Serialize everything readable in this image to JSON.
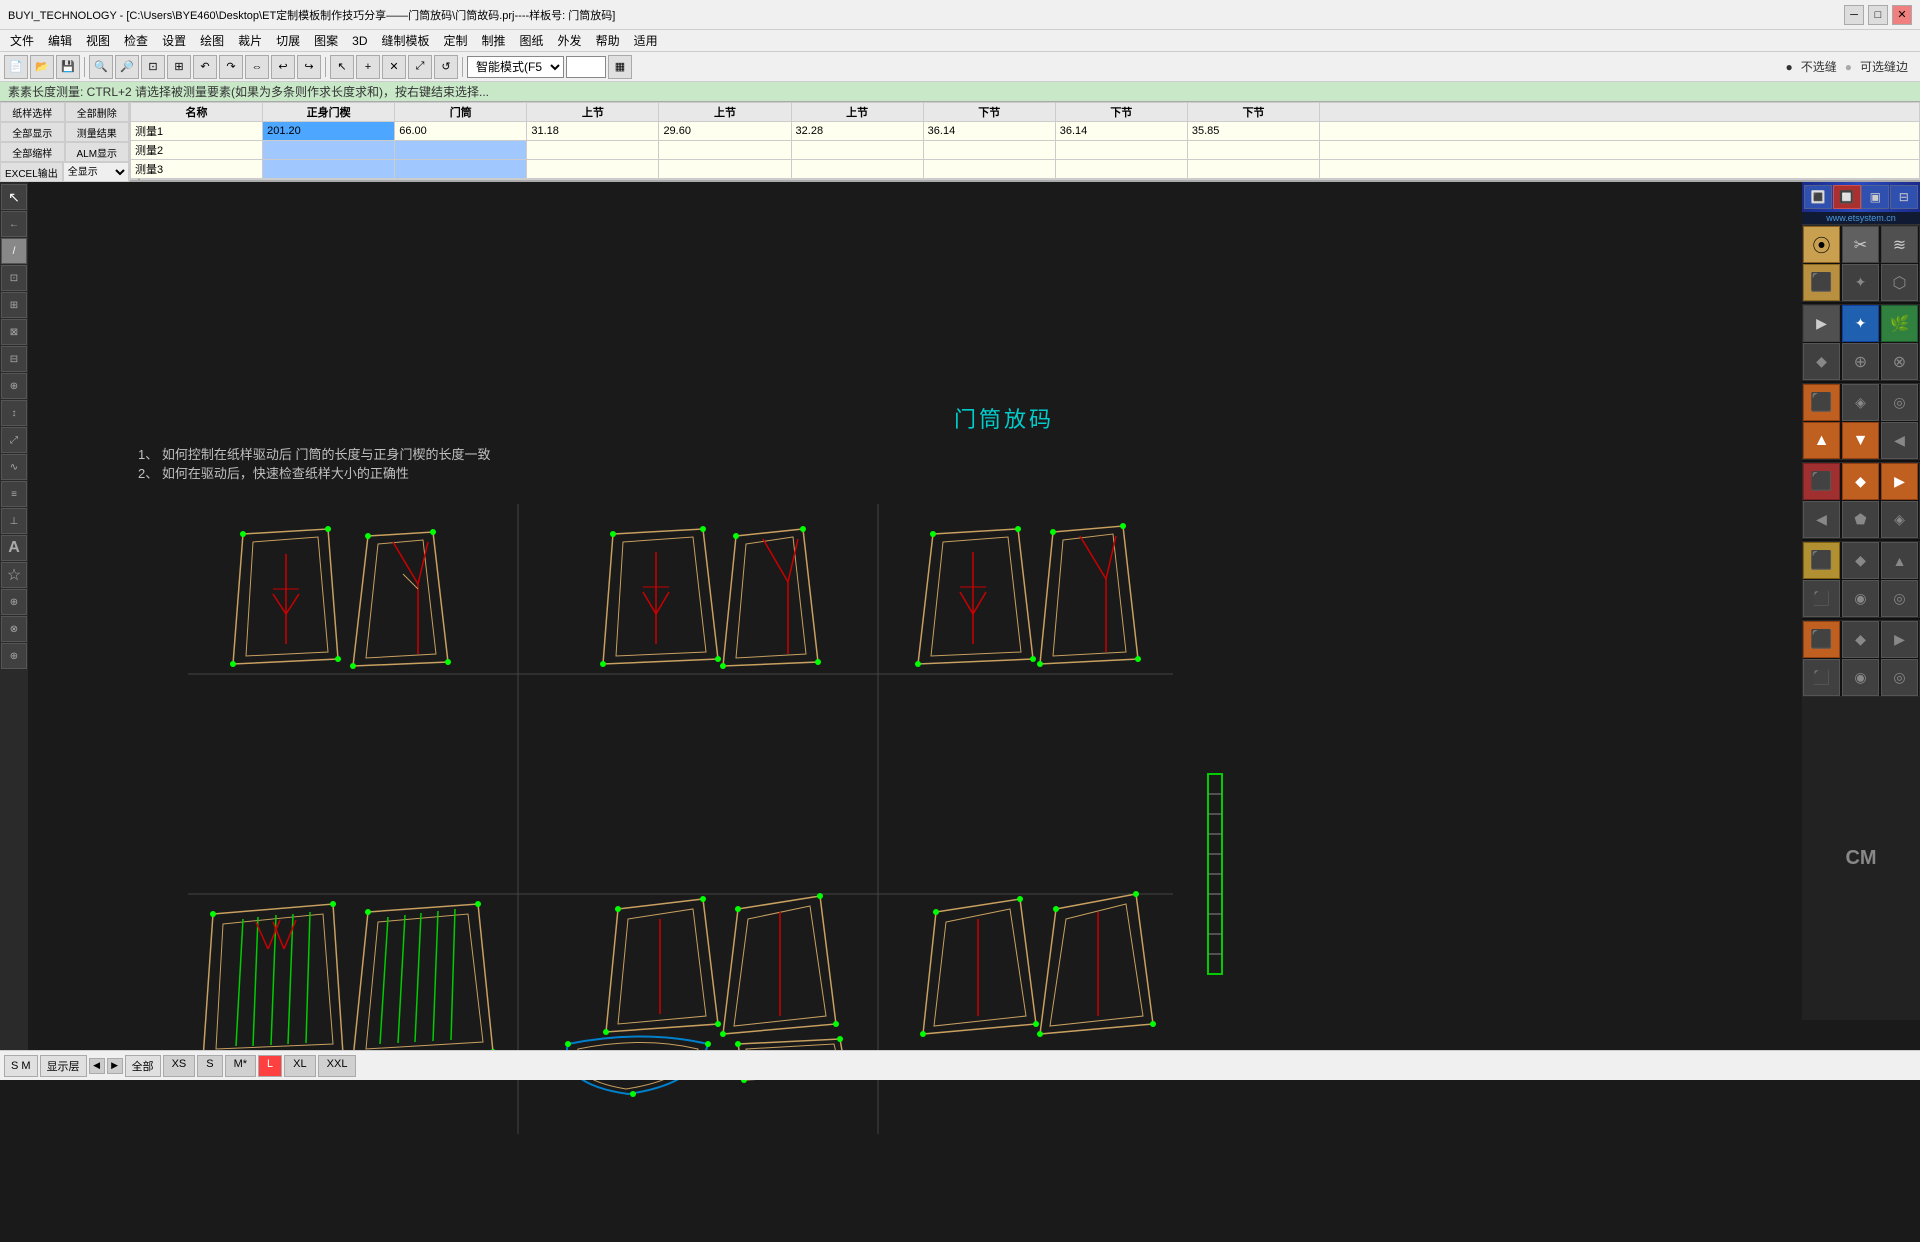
{
  "titlebar": {
    "title": "BUYI_TECHNOLOGY - [C:\\Users\\BYE460\\Desktop\\ET定制模板制作技巧分享——门筒放码\\门筒故码.prj----样板号: 门筒放码]",
    "minimize": "─",
    "maximize": "□",
    "close": "✕"
  },
  "menubar": {
    "items": [
      "文件",
      "编辑",
      "视图",
      "检查",
      "设置",
      "绘图",
      "裁片",
      "切展",
      "图案",
      "3D",
      "缝制模板",
      "定制",
      "制推",
      "图纸",
      "外发",
      "帮助",
      "适用"
    ]
  },
  "statusbar_top": {
    "text": "素素长度测量: CTRL+2  请选择被测量要素(如果为多条则作求长度求和)，按右键结束选择..."
  },
  "mode_label": "智能模式(F5",
  "mode_value": "",
  "measurement_table": {
    "headers": [
      "名称",
      "正身门楔",
      "门筒",
      "上节",
      "上节",
      "上节",
      "下节",
      "下节",
      "下节"
    ],
    "rows": [
      {
        "name": "测量1",
        "values": [
          "201.20",
          "66.00",
          "31.18",
          "29.60",
          "32.28",
          "36.14",
          "36.14",
          "35.85"
        ],
        "highlight": true
      },
      {
        "name": "测量2",
        "values": [
          "",
          "",
          "",
          "",
          "",
          "",
          "",
          ""
        ],
        "highlight": false
      },
      {
        "name": "测量3",
        "values": [
          "",
          "",
          "",
          "",
          "",
          "",
          "",
          ""
        ],
        "highlight": false
      }
    ]
  },
  "left_controls": {
    "top_buttons": [
      "全部删除",
      "测量结果",
      "ALM显示",
      "全显示"
    ],
    "bottom_label": "EXCEL输出",
    "bottom_select": "全显示"
  },
  "canvas": {
    "title": "门筒放码",
    "instructions": [
      "1、  如何控制在纸样驱动后   门筒的长度与正身门楔的长度一致",
      "2、  如何在驱动后，快速检查纸样大小的正确性"
    ]
  },
  "top_status": {
    "no_stitch": "不选缝",
    "can_stitch": "可选缝边"
  },
  "statusbar_bottom": {
    "s_m_label": "S M",
    "display_layer": "显示层",
    "all": "全部",
    "sizes": [
      "XS",
      "S",
      "M*",
      "L",
      "XL",
      "XXL"
    ],
    "active_size": "L"
  },
  "right_panel": {
    "url": "www.etsystem.cn",
    "cm_label": "CM",
    "sections": [
      {
        "buttons": [
          {
            "icon": "⦿",
            "type": "yellow"
          },
          {
            "icon": "✂",
            "type": "dark"
          },
          {
            "icon": "≋",
            "type": "dark"
          },
          {
            "icon": "⬛",
            "type": "yellow"
          },
          {
            "icon": "✦",
            "type": "dark"
          },
          {
            "icon": "⬡",
            "type": "dark"
          },
          {
            "icon": "◈",
            "type": "orange"
          },
          {
            "icon": "↗",
            "type": "dark"
          },
          {
            "icon": "⟲",
            "type": "dark"
          }
        ]
      },
      {
        "buttons": [
          {
            "icon": "▶",
            "type": "dark"
          },
          {
            "icon": "✦",
            "type": "blue"
          },
          {
            "icon": "🌿",
            "type": "green"
          },
          {
            "icon": "◆",
            "type": "dark"
          },
          {
            "icon": "⊕",
            "type": "dark"
          },
          {
            "icon": "⊗",
            "type": "dark"
          },
          {
            "icon": "⬟",
            "type": "dark"
          },
          {
            "icon": "⬠",
            "type": "dark"
          },
          {
            "icon": "◉",
            "type": "dark"
          }
        ]
      },
      {
        "buttons": [
          {
            "icon": "⬛",
            "type": "orange"
          },
          {
            "icon": "◈",
            "type": "dark"
          },
          {
            "icon": "◎",
            "type": "dark"
          },
          {
            "icon": "▲",
            "type": "orange"
          },
          {
            "icon": "▼",
            "type": "orange"
          },
          {
            "icon": "◀",
            "type": "dark"
          },
          {
            "icon": "⬡",
            "type": "dark"
          },
          {
            "icon": "⬢",
            "type": "dark"
          },
          {
            "icon": "✕",
            "type": "dark"
          }
        ]
      },
      {
        "buttons": [
          {
            "icon": "⬛",
            "type": "red"
          },
          {
            "icon": "◆",
            "type": "orange"
          },
          {
            "icon": "▶",
            "type": "orange"
          },
          {
            "icon": "◀",
            "type": "dark"
          },
          {
            "icon": "⬟",
            "type": "dark"
          },
          {
            "icon": "◈",
            "type": "dark"
          },
          {
            "icon": "⬠",
            "type": "dark"
          },
          {
            "icon": "⬡",
            "type": "dark"
          },
          {
            "icon": "✦",
            "type": "dark"
          }
        ]
      },
      {
        "buttons": [
          {
            "icon": "⬛",
            "type": "yellow"
          },
          {
            "icon": "◆",
            "type": "dark"
          },
          {
            "icon": "▲",
            "type": "dark"
          },
          {
            "icon": "⬛",
            "type": "dark"
          },
          {
            "icon": "◉",
            "type": "dark"
          },
          {
            "icon": "◎",
            "type": "dark"
          },
          {
            "icon": "⬟",
            "type": "dark"
          },
          {
            "icon": "⬠",
            "type": "dark"
          },
          {
            "icon": "⬡",
            "type": "dark"
          }
        ]
      },
      {
        "buttons": [
          {
            "icon": "⬛",
            "type": "orange"
          },
          {
            "icon": "◆",
            "type": "dark"
          },
          {
            "icon": "▶",
            "type": "dark"
          },
          {
            "icon": "⬛",
            "type": "dark"
          },
          {
            "icon": "◉",
            "type": "dark"
          },
          {
            "icon": "◎",
            "type": "dark"
          },
          {
            "icon": "⬟",
            "type": "dark"
          },
          {
            "icon": "⬠",
            "type": "dark"
          },
          {
            "icon": "⬡",
            "type": "dark"
          }
        ]
      }
    ]
  }
}
